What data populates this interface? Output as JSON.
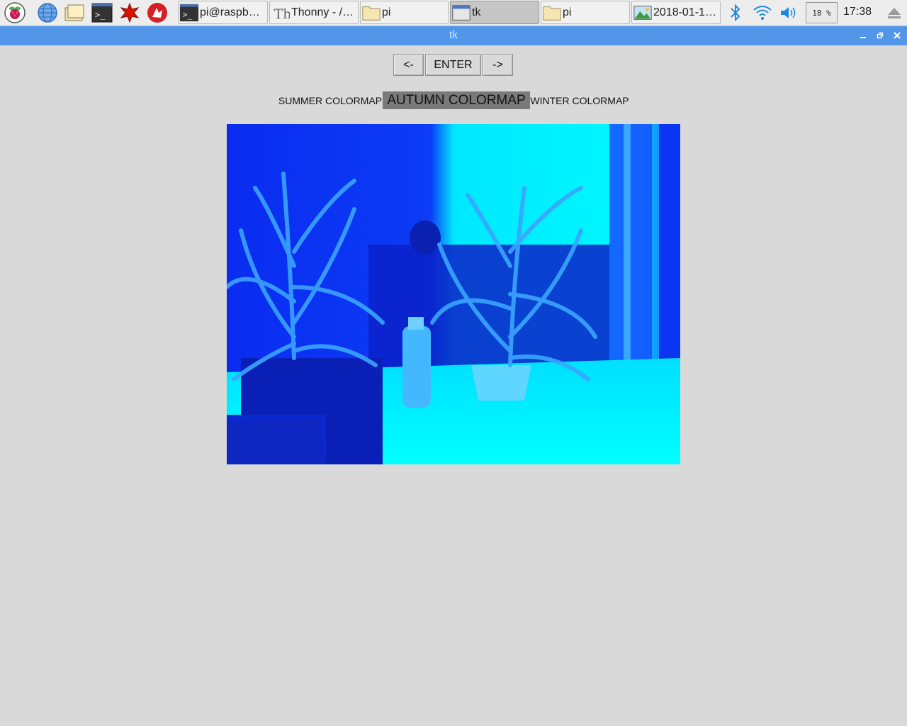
{
  "taskbar": {
    "launchers": [
      {
        "name": "raspberry-menu-icon"
      },
      {
        "name": "web-browser-icon"
      },
      {
        "name": "file-manager-icon"
      },
      {
        "name": "terminal-icon"
      },
      {
        "name": "mathematica-icon"
      },
      {
        "name": "wolfram-icon"
      }
    ],
    "tasks": [
      {
        "label": "pi@raspbe…",
        "icon": "terminal-icon"
      },
      {
        "label": "Thonny  -  /…",
        "icon": "thonny-icon"
      },
      {
        "label": "pi",
        "icon": "folder-icon"
      },
      {
        "label": "tk",
        "icon": "window-icon",
        "active": true
      },
      {
        "label": "pi",
        "icon": "folder-icon"
      },
      {
        "label": "2018-01-1…",
        "icon": "image-viewer-icon"
      }
    ],
    "tray": {
      "cpu": "18 %",
      "clock": "17:38"
    }
  },
  "window": {
    "title": "tk",
    "minimize": "–",
    "maximize": "▫",
    "close": "✕"
  },
  "controls": {
    "prev_label": "<-",
    "enter_label": "ENTER",
    "next_label": "->"
  },
  "colormaps": {
    "options": [
      "SUMMER COLORMAP",
      "AUTUMN COLORMAP",
      "WINTER COLORMAP"
    ],
    "selected": "AUTUMN COLORMAP"
  },
  "colors": {
    "titlebar": "#5196e9",
    "background": "#d9d9d9",
    "selected_bg": "#7a7a7a",
    "preview_cyan": "#00ffff",
    "preview_blue": "#0a2cf0"
  }
}
